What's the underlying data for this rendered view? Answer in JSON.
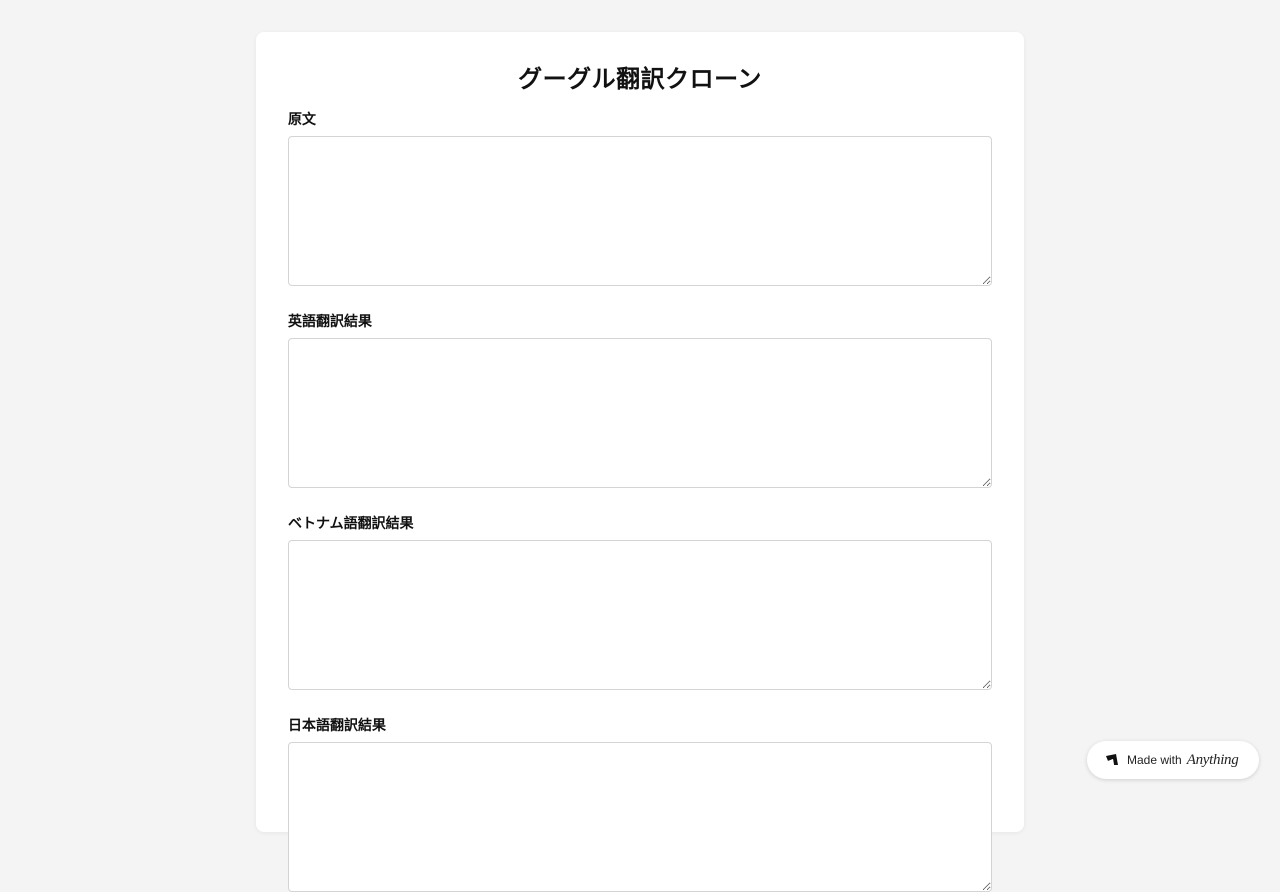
{
  "page": {
    "title": "グーグル翻訳クローン"
  },
  "fields": [
    {
      "label": "原文",
      "value": "",
      "placeholder": ""
    },
    {
      "label": "英語翻訳結果",
      "value": "",
      "placeholder": ""
    },
    {
      "label": "ベトナム語翻訳結果",
      "value": "",
      "placeholder": ""
    },
    {
      "label": "日本語翻訳結果",
      "value": "",
      "placeholder": ""
    }
  ],
  "badge": {
    "prefix": "Made with",
    "brand": "Anything",
    "icon": "anything-logo-icon"
  },
  "colors": {
    "background": "#f4f4f4",
    "card": "#ffffff",
    "border": "#d4d4d4"
  }
}
